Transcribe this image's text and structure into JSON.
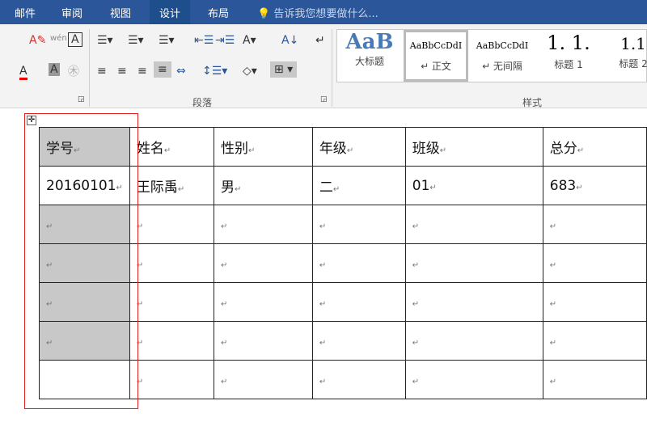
{
  "tabs": [
    "邮件",
    "审阅",
    "视图",
    "设计",
    "布局"
  ],
  "active_tab": "设计",
  "tell_me": "告诉我您想要做什么...",
  "groups": {
    "paragraph": "段落",
    "styles": "样式"
  },
  "styles": [
    {
      "preview": "AaB",
      "label": "大标题"
    },
    {
      "preview": "AaBbCcDdI",
      "label": "↵ 正文"
    },
    {
      "preview": "AaBbCcDdI",
      "label": "↵ 无间隔"
    },
    {
      "preview": "1. 1.",
      "label": "标题 1"
    },
    {
      "preview": "1.1",
      "label": "标题 2"
    }
  ],
  "table": {
    "headers": [
      "学号",
      "姓名",
      "性别",
      "年级",
      "班级",
      "总分"
    ],
    "row1": [
      "20160101",
      "王际禹",
      "男",
      "二",
      "01",
      "683"
    ],
    "mark": "↵"
  }
}
